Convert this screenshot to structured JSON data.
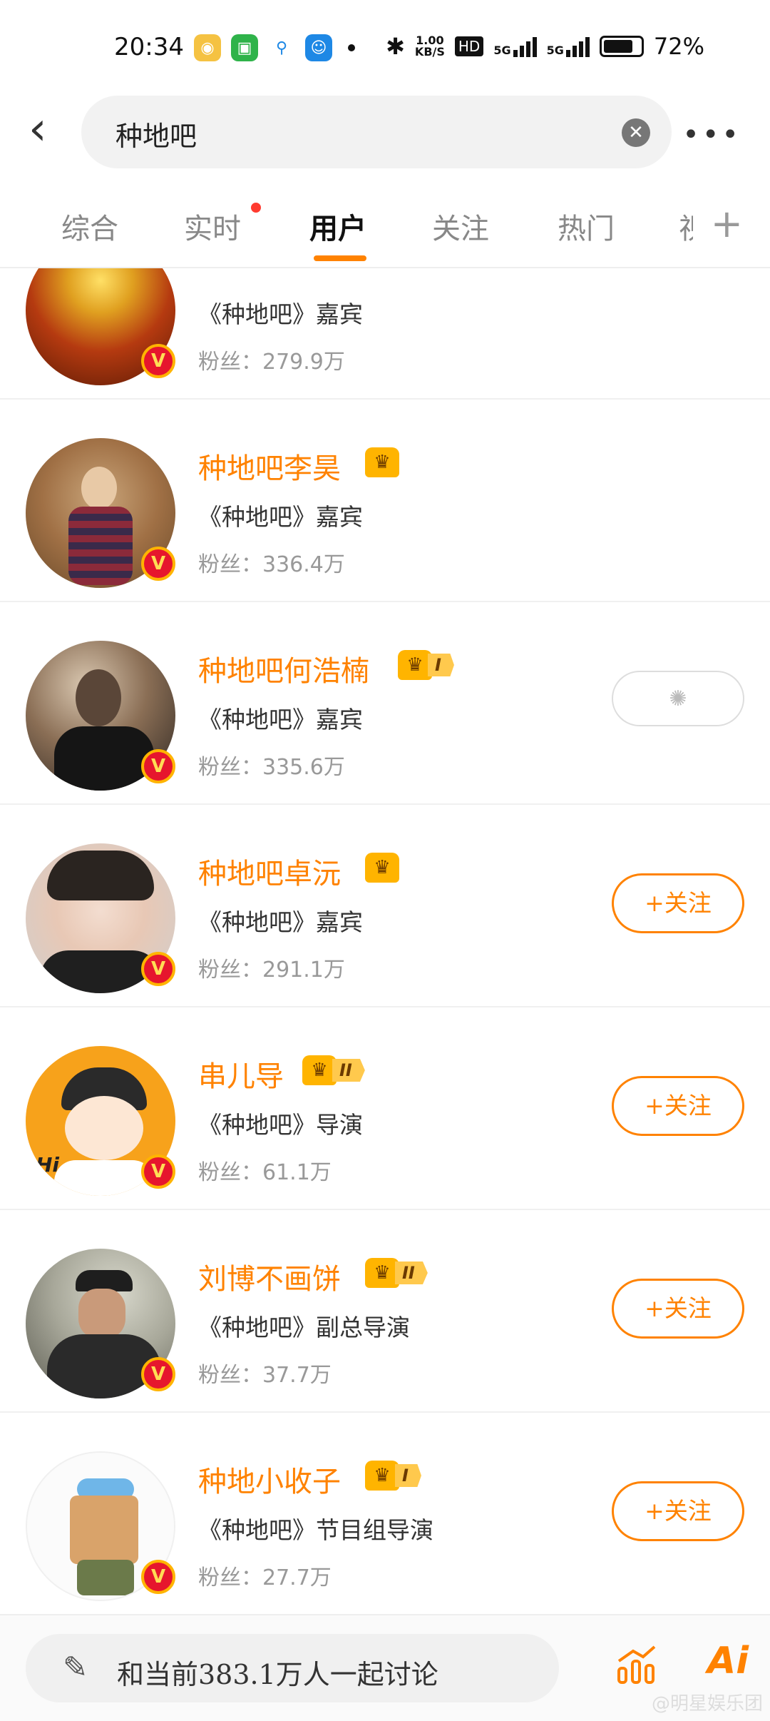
{
  "status_bar": {
    "time": "20:34",
    "net_speed": "1.00",
    "net_unit": "KB/S",
    "hd": "HD",
    "network_1": "5G",
    "network_2": "5G",
    "battery": "72%"
  },
  "search": {
    "query": "种地吧"
  },
  "tabs": [
    {
      "label": "综合"
    },
    {
      "label": "实时"
    },
    {
      "label": "用户"
    },
    {
      "label": "关注"
    },
    {
      "label": "热门"
    },
    {
      "label": "视"
    }
  ],
  "results": [
    {
      "name": "",
      "desc": "《种地吧》嘉宾",
      "fans": "粉丝：279.9万",
      "badge": "V",
      "level": "",
      "follow": ""
    },
    {
      "name": "种地吧李昊",
      "desc": "《种地吧》嘉宾",
      "fans": "粉丝：336.4万",
      "badge": "V",
      "level": "",
      "follow": ""
    },
    {
      "name": "种地吧何浩楠",
      "desc": "《种地吧》嘉宾",
      "fans": "粉丝：335.6万",
      "badge": "V",
      "level": "I",
      "follow": ""
    },
    {
      "name": "种地吧卓沅",
      "desc": "《种地吧》嘉宾",
      "fans": "粉丝：291.1万",
      "badge": "V",
      "level": "",
      "follow": "+关注"
    },
    {
      "name": "串儿导",
      "desc": "《种地吧》导演",
      "fans": "粉丝：61.1万",
      "badge": "V",
      "level": "II",
      "follow": "+关注"
    },
    {
      "name": "刘博不画饼",
      "desc": "《种地吧》副总导演",
      "fans": "粉丝：37.7万",
      "badge": "V",
      "level": "II",
      "follow": "+关注"
    },
    {
      "name": "种地小收子",
      "desc": "《种地吧》节目组导演",
      "fans": "粉丝：27.7万",
      "badge": "V",
      "level": "I",
      "follow": "+关注"
    }
  ],
  "bottom": {
    "discuss_text": "和当前383.1万人一起讨论",
    "ai_label": "Ai",
    "watermark": "@明星娱乐团"
  },
  "colors": {
    "accent": "#ff8200",
    "badge_red": "#e6162d",
    "red_dot": "#ff3b30"
  }
}
